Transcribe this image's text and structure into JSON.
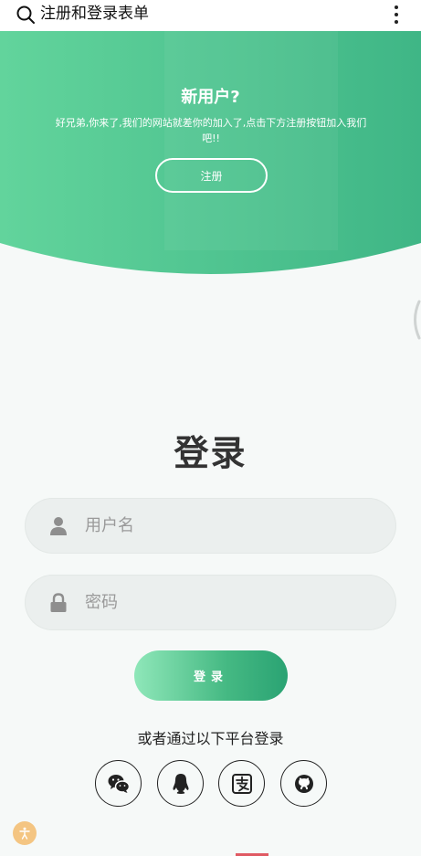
{
  "topbar": {
    "title": "注册和登录表单",
    "search_icon": "search-icon",
    "menu_icon": "more-vertical-icon"
  },
  "hero": {
    "title": "新用户?",
    "description": "好兄弟,你来了,我们的网站就差你的加入了,点击下方注册按钮加入我们吧!!",
    "register_label": "注册",
    "gradient": [
      "#62d49c",
      "#3fb686"
    ]
  },
  "login": {
    "title": "登录",
    "username_placeholder": "用户名",
    "password_placeholder": "密码",
    "submit_label": "登录",
    "alt_text": "或者通过以下平台登录"
  },
  "social": [
    {
      "icon": "wechat-icon"
    },
    {
      "icon": "qq-icon"
    },
    {
      "icon": "alipay-icon"
    },
    {
      "icon": "github-icon"
    }
  ],
  "colors": {
    "accent": "#45b983",
    "background": "#f6f9f8",
    "field": "#ebefee",
    "text": "#333333"
  }
}
